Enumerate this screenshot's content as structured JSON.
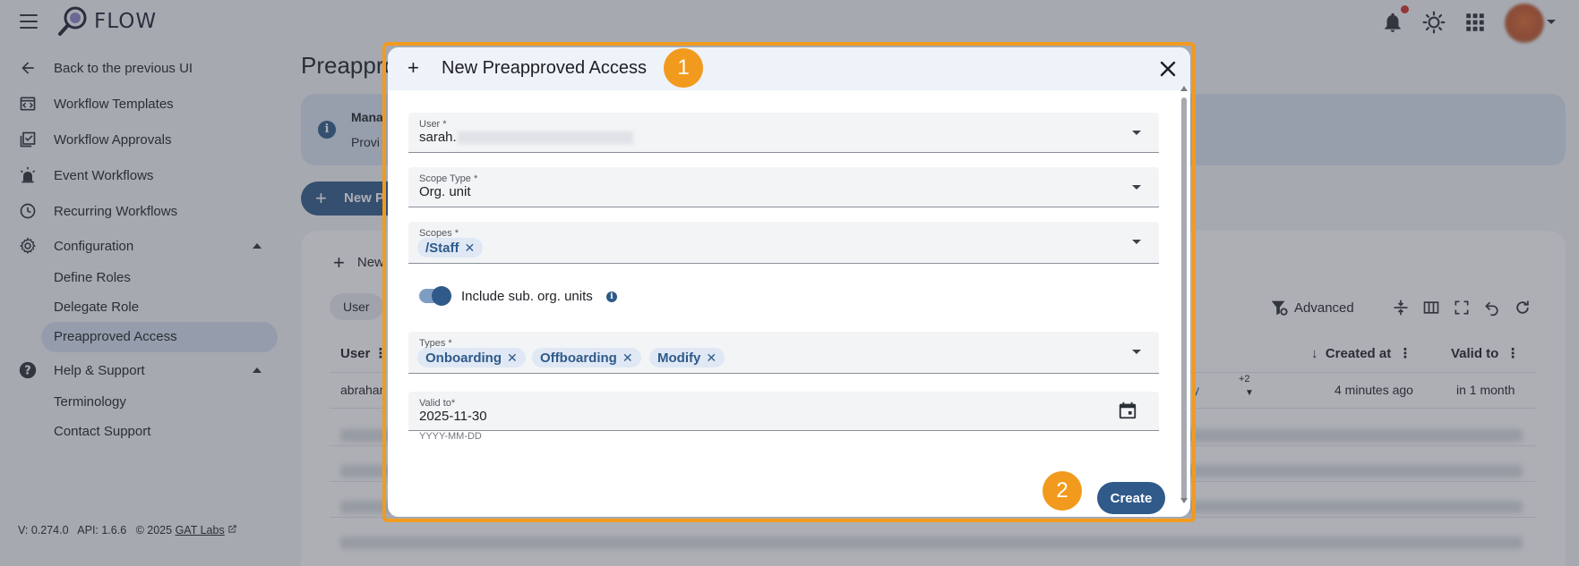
{
  "app": {
    "name": "FLOW"
  },
  "sidebar": {
    "back": "Back to the previous UI",
    "items": [
      {
        "label": "Workflow Templates",
        "icon": "code-window-icon"
      },
      {
        "label": "Workflow Approvals",
        "icon": "checklist-icon"
      },
      {
        "label": "Event Workflows",
        "icon": "alarm-light-icon"
      },
      {
        "label": "Recurring Workflows",
        "icon": "clock-icon"
      }
    ],
    "configuration": {
      "label": "Configuration",
      "children": [
        "Define Roles",
        "Delegate Role",
        "Preapproved Access"
      ],
      "active": "Preapproved Access"
    },
    "help": {
      "label": "Help & Support",
      "children": [
        "Terminology",
        "Contact Support"
      ]
    },
    "version": {
      "v": "V: 0.274.0",
      "api": "API: 1.6.6",
      "copyright": "© 2025",
      "company": "GAT Labs"
    }
  },
  "main": {
    "title": "Preappro",
    "banner": {
      "line1": "Mana",
      "line2": "Provi"
    },
    "new_button": "New P",
    "table": {
      "new_link": "New",
      "filter_chip": "User",
      "advanced": "Advanced",
      "columns": [
        "User",
        "Created at",
        "Valid to"
      ],
      "first_row": {
        "user": "abrahan",
        "type_fragment": "y",
        "more": "+2",
        "created": "4 minutes ago",
        "valid": "in 1 month"
      }
    }
  },
  "dialog": {
    "title": "New Preapproved Access",
    "fields": {
      "user": {
        "label": "User *",
        "value": "sarah."
      },
      "scope_type": {
        "label": "Scope Type *",
        "value": "Org. unit"
      },
      "scopes": {
        "label": "Scopes *",
        "chips": [
          "/Staff"
        ]
      },
      "include_sub": {
        "label": "Include sub. org. units",
        "checked": true
      },
      "types": {
        "label": "Types *",
        "chips": [
          "Onboarding",
          "Offboarding",
          "Modify"
        ]
      },
      "valid_to": {
        "label": "Valid to*",
        "value": "2025-11-30",
        "hint": "YYYY-MM-DD"
      }
    },
    "create_button": "Create"
  },
  "annotations": {
    "badge1": "1",
    "badge2": "2",
    "highlight_color": "#f29a1d"
  },
  "colors": {
    "primary": "#2f5a8a",
    "chip_bg": "#dfe8f4",
    "active_nav_bg": "#d6dff0"
  }
}
